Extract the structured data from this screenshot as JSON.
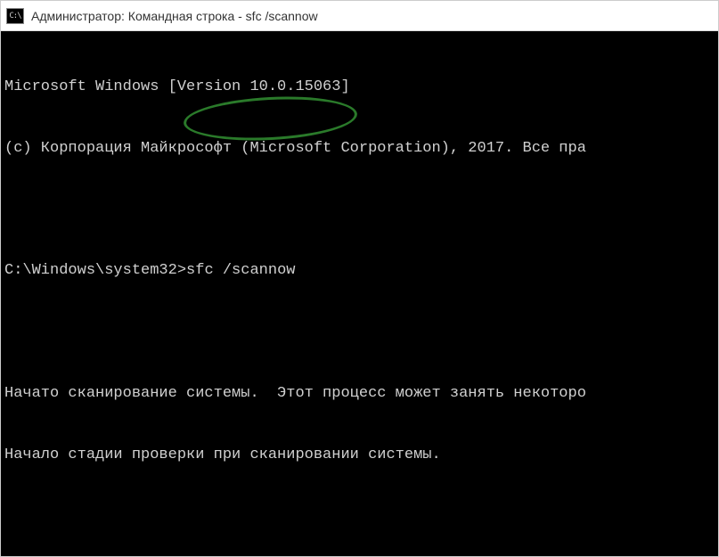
{
  "titlebar": {
    "icon_label": "C:\\",
    "title": "Администратор: Командная строка - sfc  /scannow"
  },
  "terminal": {
    "line1": "Microsoft Windows [Version 10.0.15063]",
    "line2": "(c) Корпорация Майкрософт (Microsoft Corporation), 2017. Все пра",
    "prompt": "C:\\Windows\\system32>",
    "command": "sfc /scannow",
    "line4": "Начато сканирование системы.  Этот процесс может занять некоторо",
    "line5": "Начало стадии проверки при сканировании системы."
  }
}
